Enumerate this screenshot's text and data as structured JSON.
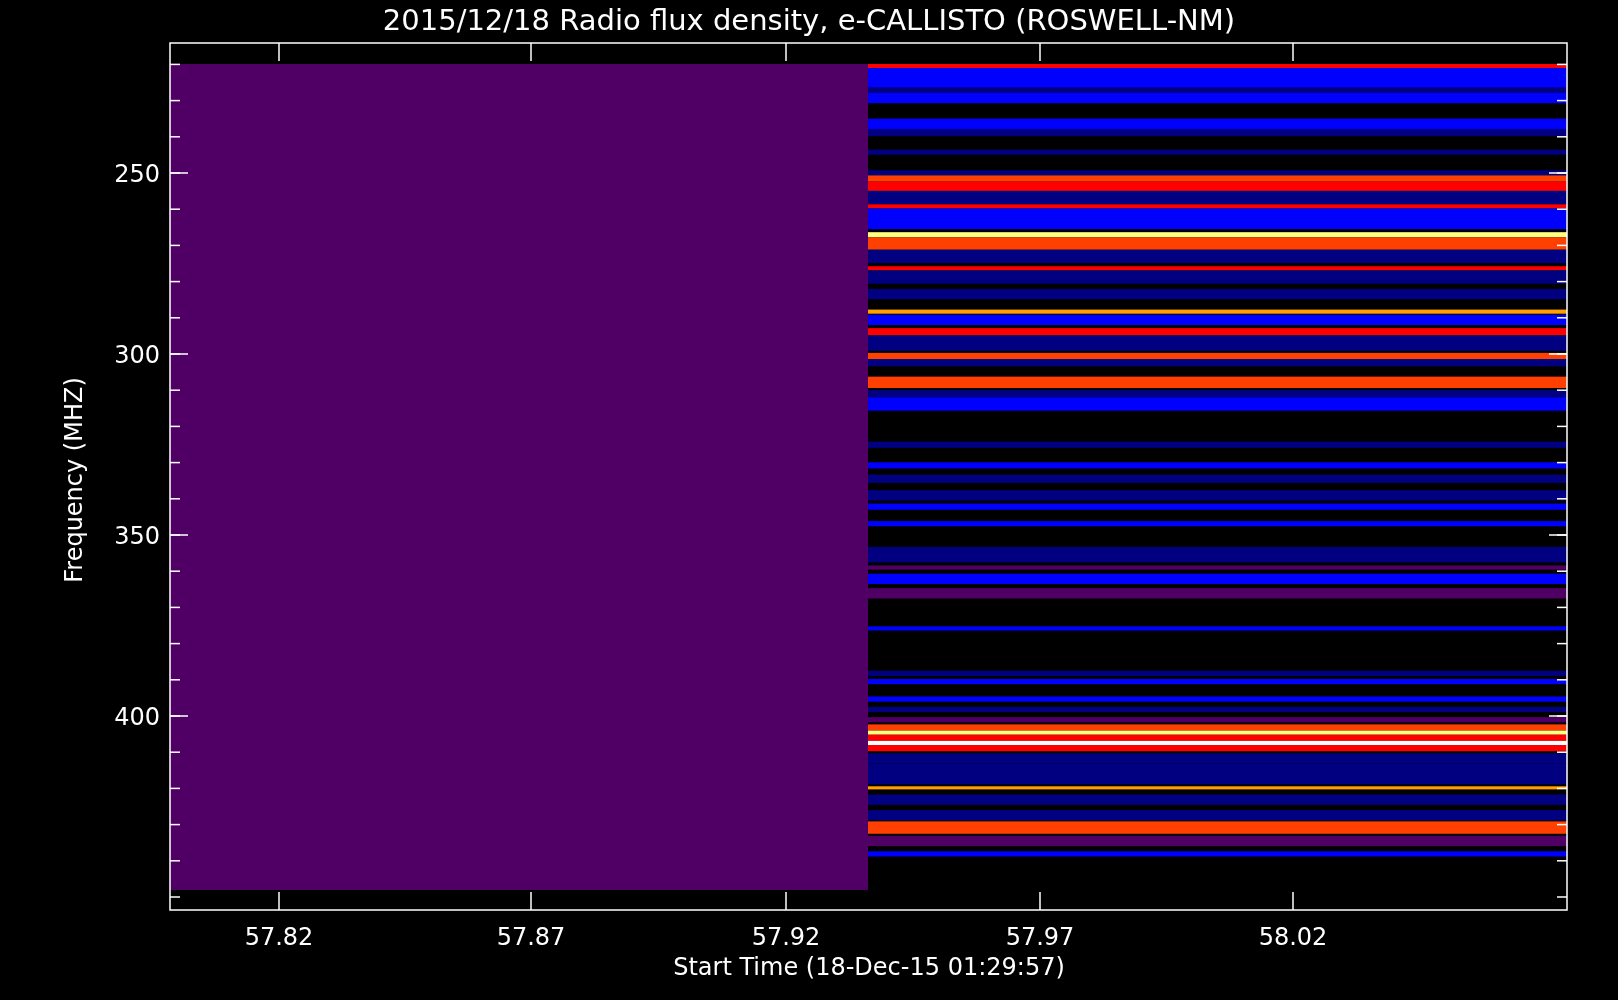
{
  "title": "2015/12/18  Radio flux density, e-CALLISTO (ROSWELL-NM)",
  "y_axis": {
    "label": "Frequency (MHZ)",
    "ticks": [
      "250",
      "300",
      "350",
      "400"
    ]
  },
  "x_axis": {
    "label": "Start Time (18-Dec-15 01:29:57)",
    "ticks": [
      "57.82",
      "57.87",
      "57.92",
      "57.97",
      "58.02"
    ]
  }
}
